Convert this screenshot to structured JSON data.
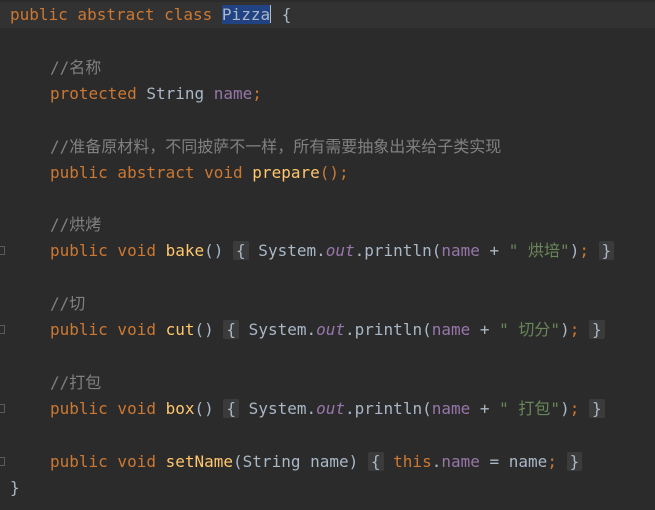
{
  "code": {
    "line1": {
      "kw": "public abstract class ",
      "selected_name": "Pizza",
      "brace": " {"
    },
    "comment_name": "//名称",
    "line_field": {
      "kw": "protected ",
      "type": "String ",
      "name": "name",
      "semi": ";"
    },
    "comment_prepare": "//准备原材料，不同披萨不一样，所有需要抽象出来给子类实现",
    "line_prepare": {
      "kw": "public abstract void ",
      "fn": "prepare",
      "rest": "();"
    },
    "comment_bake": "//烘烤",
    "line_bake": {
      "kw": "public void ",
      "fn": "bake",
      "parens": "() ",
      "open": "{",
      "sys": " System.",
      "out": "out",
      "println": ".println(",
      "field": "name",
      "plus": " + ",
      "str": "\" 烘培\"",
      "close_paren": ")",
      "semi": ";",
      "close": "}"
    },
    "comment_cut": "//切",
    "line_cut": {
      "kw": "public void ",
      "fn": "cut",
      "parens": "() ",
      "open": "{",
      "sys": " System.",
      "out": "out",
      "println": ".println(",
      "field": "name",
      "plus": " + ",
      "str": "\" 切分\"",
      "close_paren": ")",
      "semi": ";",
      "close": "}"
    },
    "comment_box": "//打包",
    "line_box": {
      "kw": "public void ",
      "fn": "box",
      "parens": "() ",
      "open": "{",
      "sys": " System.",
      "out": "out",
      "println": ".println(",
      "field": "name",
      "plus": " + ",
      "str": "\" 打包\"",
      "close_paren": ")",
      "semi": ";",
      "close": "}"
    },
    "line_setname": {
      "kw": "public void ",
      "fn": "setName",
      "params": "(String name) ",
      "open": "{",
      "this": " this",
      "dot": ".",
      "field": "name",
      "assign": " = name",
      "semi": ";",
      "close": "}"
    },
    "final_brace": "}"
  }
}
